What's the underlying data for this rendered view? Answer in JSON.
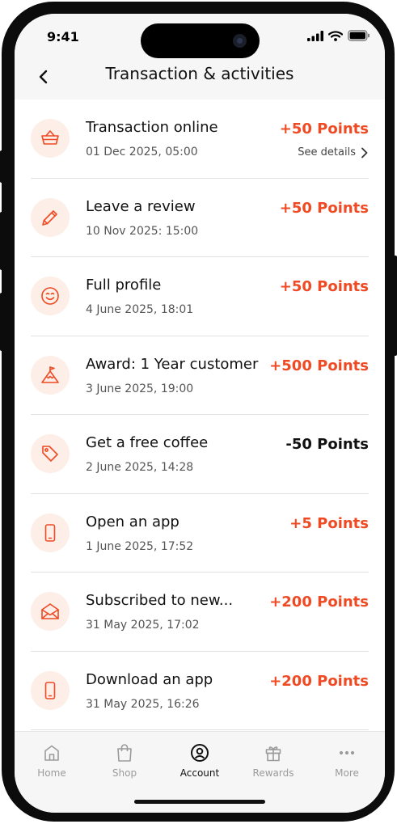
{
  "status": {
    "time": "9:41"
  },
  "header": {
    "title": "Transaction & activities"
  },
  "transactions": [
    {
      "icon": "basket-icon",
      "title": "Transaction online",
      "date": "01 Dec 2025, 05:00",
      "points": "+50 Points",
      "details": "See details"
    },
    {
      "icon": "pencil-icon",
      "title": "Leave a review",
      "date": "10 Nov 2025: 15:00",
      "points": "+50 Points"
    },
    {
      "icon": "smiley-icon",
      "title": "Full profile",
      "date": "4 June 2025, 18:01",
      "points": "+50 Points"
    },
    {
      "icon": "mountain-flag-icon",
      "title": "Award: 1 Year customer",
      "date": "3 June 2025, 19:00",
      "points": "+500 Points"
    },
    {
      "icon": "tag-icon",
      "title": "Get a free coffee",
      "date": "2 June 2025, 14:28",
      "points": "-50 Points"
    },
    {
      "icon": "phone-icon",
      "title": "Open an app",
      "date": "1 June 2025, 17:52",
      "points": "+5 Points"
    },
    {
      "icon": "envelope-icon",
      "title": "Subscribed to new...",
      "date": "31 May 2025, 17:02",
      "points": "+200 Points"
    },
    {
      "icon": "phone-icon",
      "title": "Download an app",
      "date": "31 May 2025, 16:26",
      "points": "+200 Points"
    }
  ],
  "tabbar": {
    "active": "Account",
    "items": [
      {
        "label": "Home",
        "icon": "home-icon"
      },
      {
        "label": "Shop",
        "icon": "bag-icon"
      },
      {
        "label": "Account",
        "icon": "account-icon"
      },
      {
        "label": "Rewards",
        "icon": "gift-icon"
      },
      {
        "label": "More",
        "icon": "more-icon"
      }
    ]
  },
  "colors": {
    "accent": "#ef4a23",
    "icon_bg": "#fdeee8",
    "header_bg": "#f6f6f6"
  }
}
